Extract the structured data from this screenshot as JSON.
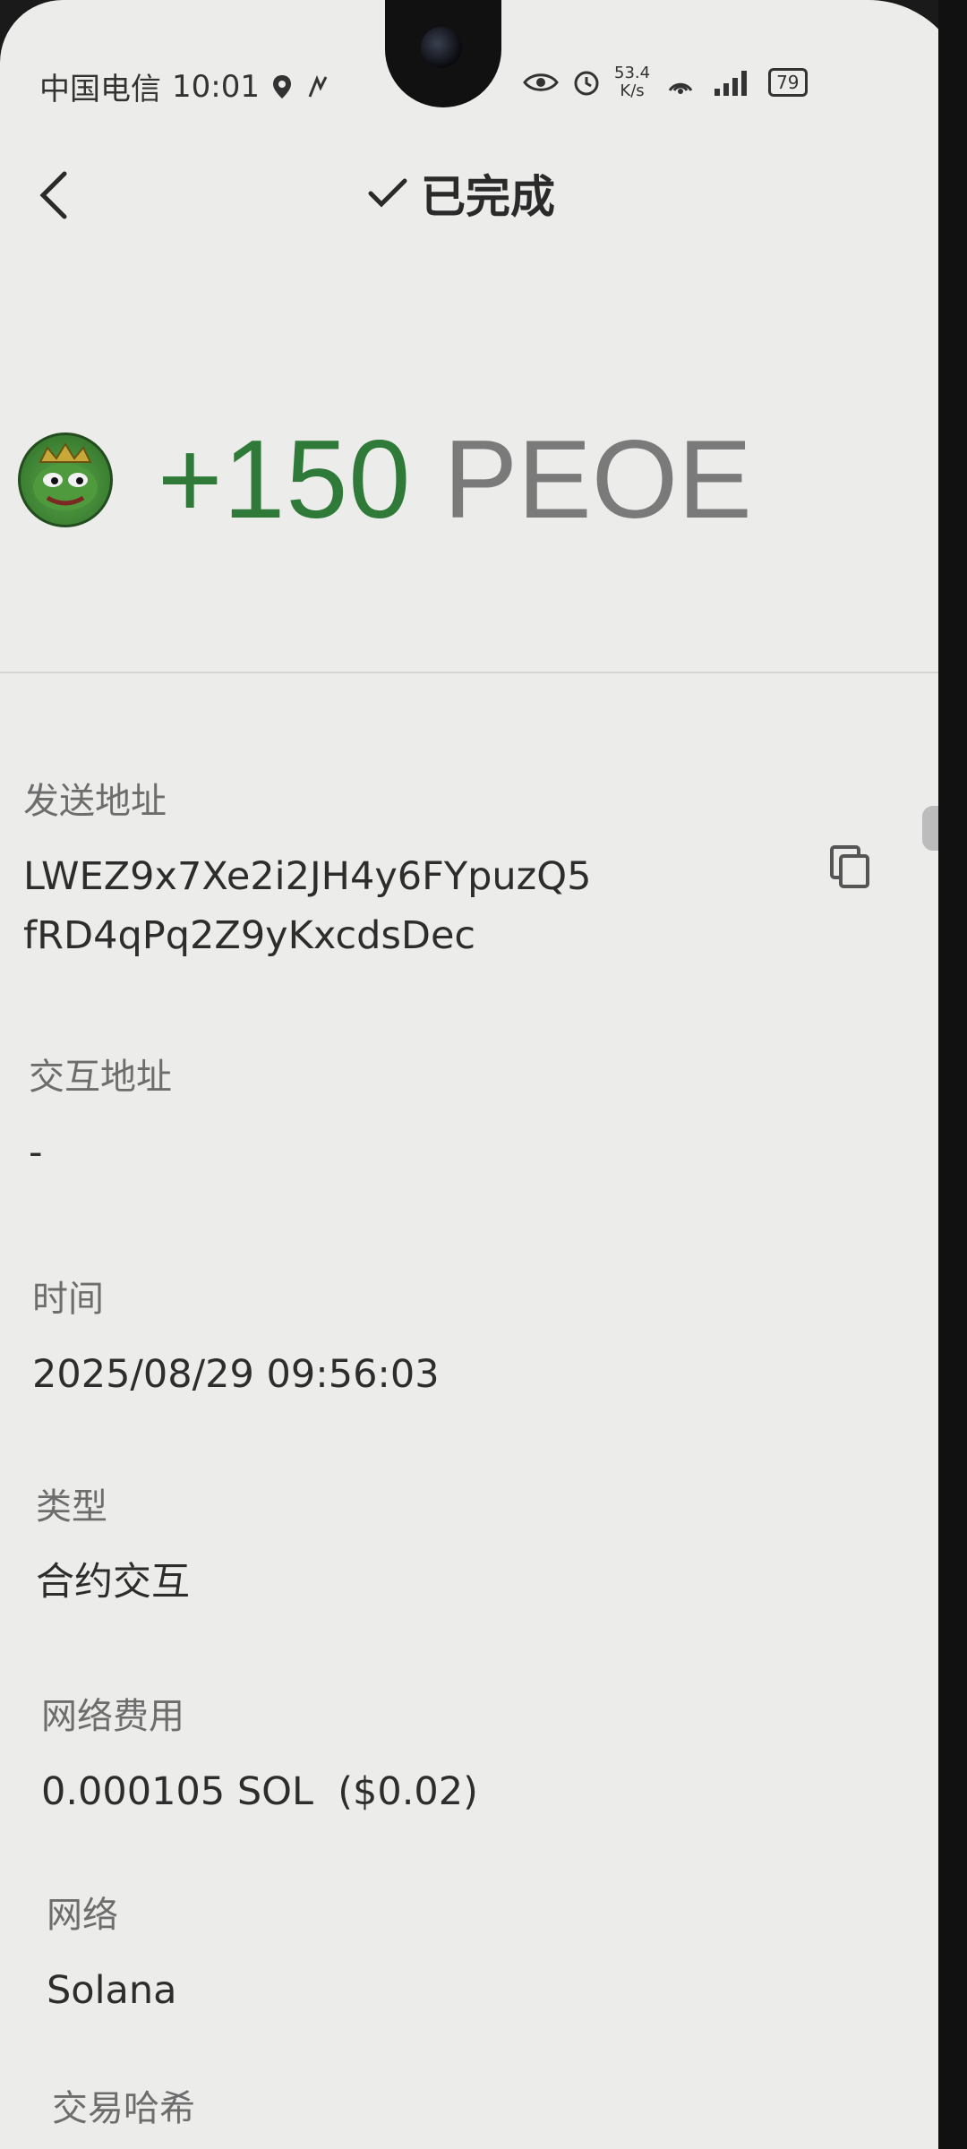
{
  "status_bar": {
    "carrier": "中国电信",
    "time": "10:01",
    "net_speed_value": "53.4",
    "net_speed_unit": "K/s",
    "battery": "79"
  },
  "header": {
    "title": "已完成"
  },
  "transaction": {
    "amount": "+150",
    "symbol": "PEOE"
  },
  "fields": {
    "sender": {
      "label": "发送地址",
      "value_line1": "LWEZ9x7Xe2i2JH4y6FYpuzQ5",
      "value_line2": "fRD4qPq2Z9yKxcdsDec"
    },
    "counterparty": {
      "label": "交互地址",
      "value": "-"
    },
    "time": {
      "label": "时间",
      "value": "2025/08/29 09:56:03"
    },
    "type": {
      "label": "类型",
      "value": "合约交互"
    },
    "fee": {
      "label": "网络费用",
      "value": "0.000105 SOL  ($0.02)"
    },
    "network": {
      "label": "网络",
      "value": "Solana"
    },
    "tx_hash": {
      "label": "交易哈希"
    }
  },
  "colors": {
    "amount_green": "#2f7a38",
    "symbol_gray": "#7a7a7a",
    "background": "#ececea"
  },
  "icons": {
    "back": "chevron-left-icon",
    "title_check": "check-icon",
    "copy": "copy-icon",
    "token": "pepe-token-icon"
  }
}
